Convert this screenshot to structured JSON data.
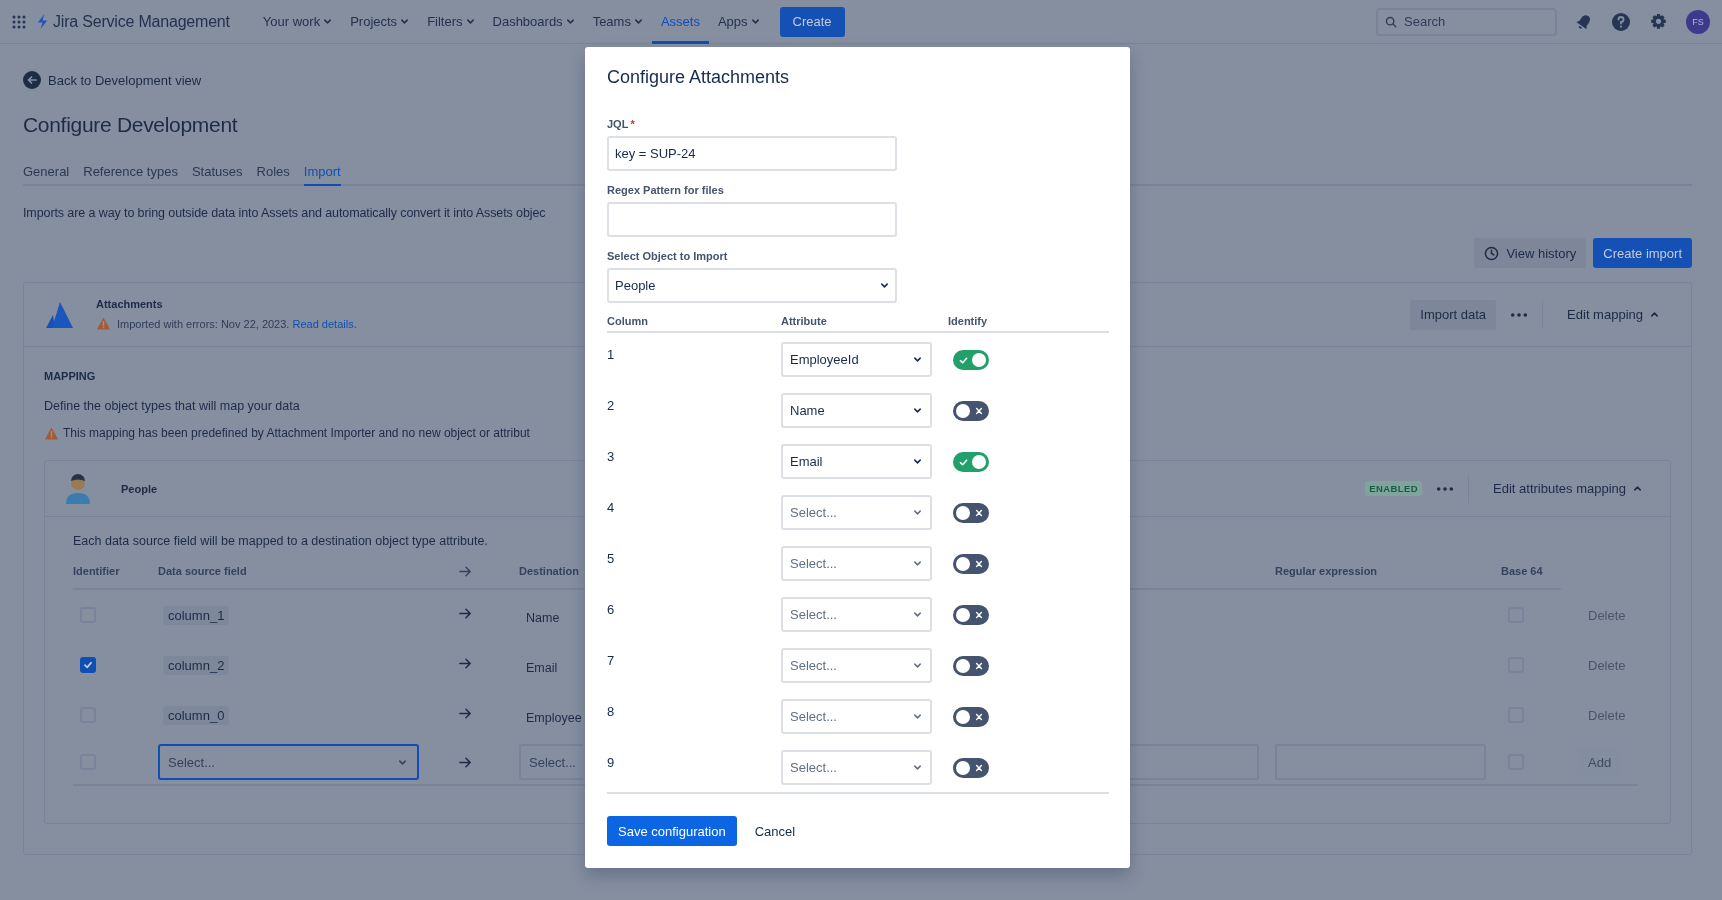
{
  "top_bar": {
    "product": "Jira Service Management",
    "nav": [
      {
        "label": "Your work",
        "selected": false,
        "dropdown": true
      },
      {
        "label": "Projects",
        "selected": false,
        "dropdown": true
      },
      {
        "label": "Filters",
        "selected": false,
        "dropdown": true
      },
      {
        "label": "Dashboards",
        "selected": false,
        "dropdown": true
      },
      {
        "label": "Teams",
        "selected": false,
        "dropdown": true
      },
      {
        "label": "Assets",
        "selected": true,
        "dropdown": false
      },
      {
        "label": "Apps",
        "selected": false,
        "dropdown": true
      }
    ],
    "create": "Create",
    "search": {
      "placeholder": "Search"
    },
    "avatar": "FS"
  },
  "page": {
    "back_link": "Back to Development view",
    "title": "Configure Development",
    "tabs": [
      {
        "label": "General",
        "selected": false
      },
      {
        "label": "Reference types",
        "selected": false
      },
      {
        "label": "Statuses",
        "selected": false
      },
      {
        "label": "Roles",
        "selected": false
      },
      {
        "label": "Import",
        "selected": true
      }
    ],
    "description": "Imports are a way to bring outside data into Assets and automatically convert it into Assets objec",
    "actions": {
      "history": "View history",
      "create": "Create import"
    }
  },
  "import_card": {
    "name": "Attachments",
    "status": "Imported with errors: Nov 22, 2023.",
    "status_link": "Read details.",
    "import_button": "Import data",
    "edit_button": "Edit mapping"
  },
  "mapping": {
    "heading": "MAPPING",
    "subtitle": "Define the object types that will map your data",
    "warning": "This mapping has been predefined by Attachment Importer and no new object or attribut"
  },
  "object_type": {
    "name": "People",
    "badge": "ENABLED",
    "edit_button": "Edit attributes mapping",
    "intro": "Each data source field will be mapped to a destination object type attribute.",
    "columns": {
      "identifier": "Identifier",
      "source": "Data source field",
      "destination": "Destination",
      "regex": "Regular expression",
      "base64": "Base 64"
    },
    "rows": [
      {
        "identifier": false,
        "source": "column_1",
        "destination": "Name",
        "base64": false,
        "action": "Delete"
      },
      {
        "identifier": true,
        "source": "column_2",
        "destination": "Email",
        "base64": false,
        "action": "Delete"
      },
      {
        "identifier": false,
        "source": "column_0",
        "destination": "Employee",
        "base64": false,
        "action": "Delete"
      }
    ],
    "new_row": {
      "identifier": false,
      "source_placeholder": "Select...",
      "source_focused": true,
      "destination_placeholder": "Select...",
      "base64": false,
      "action": "Add"
    }
  },
  "dialog": {
    "title": "Configure Attachments",
    "fields": [
      {
        "kind": "text",
        "label": "JQL",
        "required_mark": "*",
        "value": "key = SUP-24"
      },
      {
        "kind": "text",
        "label": "Regex Pattern for files"
      },
      {
        "kind": "select",
        "label": "Select Object to Import",
        "value": "People"
      }
    ],
    "columns": {
      "column": "Column",
      "attribute": "Attribute",
      "identify": "Identify"
    },
    "rows": [
      {
        "column": "1",
        "attribute": "EmployeeId",
        "identify": true
      },
      {
        "column": "2",
        "attribute": "Name",
        "identify": false
      },
      {
        "column": "3",
        "attribute": "Email",
        "identify": true
      },
      {
        "column": "4",
        "placeholder": "Select...",
        "identify": false
      },
      {
        "column": "5",
        "placeholder": "Select...",
        "identify": false
      },
      {
        "column": "6",
        "placeholder": "Select...",
        "identify": false
      },
      {
        "column": "7",
        "placeholder": "Select...",
        "identify": false
      },
      {
        "column": "8",
        "placeholder": "Select...",
        "identify": false
      },
      {
        "column": "9",
        "placeholder": "Select...",
        "identify": false
      }
    ],
    "save": "Save configuration",
    "cancel": "Cancel"
  }
}
